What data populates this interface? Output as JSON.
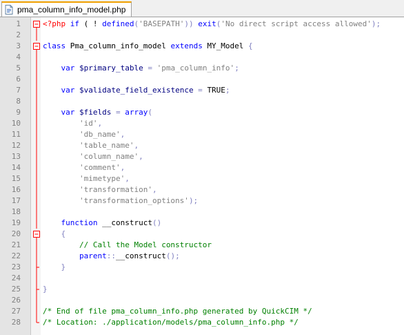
{
  "tab": {
    "title": "pma_column_info_model.php",
    "icon": "php-file-icon"
  },
  "lines": [
    {
      "n": "1",
      "fold": "open",
      "tokens": [
        [
          "php",
          "<?php "
        ],
        [
          "kw",
          "if"
        ],
        [
          "txt",
          " ( ! "
        ],
        [
          "kw",
          "defined"
        ],
        [
          "op",
          "("
        ],
        [
          "str",
          "'BASEPATH'"
        ],
        [
          "op",
          "))"
        ],
        [
          "txt",
          " "
        ],
        [
          "kw",
          "exit"
        ],
        [
          "op",
          "("
        ],
        [
          "str",
          "'No direct script access allowed'"
        ],
        [
          "op",
          ");"
        ]
      ]
    },
    {
      "n": "2",
      "fold": "line",
      "tokens": []
    },
    {
      "n": "3",
      "fold": "open",
      "tokens": [
        [
          "kw",
          "class"
        ],
        [
          "txt",
          " Pma_column_info_model "
        ],
        [
          "kw",
          "extends"
        ],
        [
          "txt",
          " MY_Model "
        ],
        [
          "brace",
          "{"
        ]
      ]
    },
    {
      "n": "4",
      "fold": "line",
      "tokens": []
    },
    {
      "n": "5",
      "fold": "line",
      "tokens": [
        [
          "txt",
          "    "
        ],
        [
          "kw",
          "var"
        ],
        [
          "var",
          " $primary_table"
        ],
        [
          "op",
          " = "
        ],
        [
          "str",
          "'pma_column_info'"
        ],
        [
          "op",
          ";"
        ]
      ]
    },
    {
      "n": "6",
      "fold": "line",
      "tokens": []
    },
    {
      "n": "7",
      "fold": "line",
      "tokens": [
        [
          "txt",
          "    "
        ],
        [
          "kw",
          "var"
        ],
        [
          "var",
          " $validate_field_existence"
        ],
        [
          "op",
          " = "
        ],
        [
          "bool",
          "TRUE"
        ],
        [
          "op",
          ";"
        ]
      ]
    },
    {
      "n": "8",
      "fold": "line",
      "tokens": []
    },
    {
      "n": "9",
      "fold": "line",
      "tokens": [
        [
          "txt",
          "    "
        ],
        [
          "kw",
          "var"
        ],
        [
          "var",
          " $fields"
        ],
        [
          "op",
          " = "
        ],
        [
          "kw",
          "array"
        ],
        [
          "op",
          "("
        ]
      ]
    },
    {
      "n": "10",
      "fold": "line",
      "tokens": [
        [
          "txt",
          "        "
        ],
        [
          "str",
          "'id'"
        ],
        [
          "op",
          ","
        ]
      ]
    },
    {
      "n": "11",
      "fold": "line",
      "tokens": [
        [
          "txt",
          "        "
        ],
        [
          "str",
          "'db_name'"
        ],
        [
          "op",
          ","
        ]
      ]
    },
    {
      "n": "12",
      "fold": "line",
      "tokens": [
        [
          "txt",
          "        "
        ],
        [
          "str",
          "'table_name'"
        ],
        [
          "op",
          ","
        ]
      ]
    },
    {
      "n": "13",
      "fold": "line",
      "tokens": [
        [
          "txt",
          "        "
        ],
        [
          "str",
          "'column_name'"
        ],
        [
          "op",
          ","
        ]
      ]
    },
    {
      "n": "14",
      "fold": "line",
      "tokens": [
        [
          "txt",
          "        "
        ],
        [
          "str",
          "'comment'"
        ],
        [
          "op",
          ","
        ]
      ]
    },
    {
      "n": "15",
      "fold": "line",
      "tokens": [
        [
          "txt",
          "        "
        ],
        [
          "str",
          "'mimetype'"
        ],
        [
          "op",
          ","
        ]
      ]
    },
    {
      "n": "16",
      "fold": "line",
      "tokens": [
        [
          "txt",
          "        "
        ],
        [
          "str",
          "'transformation'"
        ],
        [
          "op",
          ","
        ]
      ]
    },
    {
      "n": "17",
      "fold": "line",
      "tokens": [
        [
          "txt",
          "        "
        ],
        [
          "str",
          "'transformation_options'"
        ],
        [
          "op",
          ");"
        ]
      ]
    },
    {
      "n": "18",
      "fold": "line",
      "tokens": []
    },
    {
      "n": "19",
      "fold": "line",
      "tokens": [
        [
          "txt",
          "    "
        ],
        [
          "kw",
          "function"
        ],
        [
          "txt",
          " __construct"
        ],
        [
          "op",
          "()"
        ]
      ]
    },
    {
      "n": "20",
      "fold": "open",
      "tokens": [
        [
          "txt",
          "    "
        ],
        [
          "brace",
          "{"
        ]
      ]
    },
    {
      "n": "21",
      "fold": "line",
      "tokens": [
        [
          "txt",
          "        "
        ],
        [
          "com",
          "// Call the Model constructor"
        ]
      ]
    },
    {
      "n": "22",
      "fold": "line",
      "tokens": [
        [
          "txt",
          "        "
        ],
        [
          "kw",
          "parent"
        ],
        [
          "op",
          "::"
        ],
        [
          "txt",
          "__construct"
        ],
        [
          "op",
          "();"
        ]
      ]
    },
    {
      "n": "23",
      "fold": "end",
      "tokens": [
        [
          "txt",
          "    "
        ],
        [
          "brace",
          "}"
        ]
      ]
    },
    {
      "n": "24",
      "fold": "line",
      "tokens": []
    },
    {
      "n": "25",
      "fold": "end",
      "tokens": [
        [
          "brace",
          "}"
        ]
      ]
    },
    {
      "n": "26",
      "fold": "line",
      "tokens": []
    },
    {
      "n": "27",
      "fold": "line",
      "tokens": [
        [
          "com",
          "/* End of file pma_column_info.php generated by QuickCIM */"
        ]
      ]
    },
    {
      "n": "28",
      "fold": "last",
      "tokens": [
        [
          "com",
          "/* Location: ./application/models/pma_column_info.php */"
        ]
      ]
    }
  ],
  "colors": {
    "keyword": "#0000ff",
    "variable": "#000080",
    "string": "#808080",
    "comment": "#008000",
    "php_tag": "#ff0000",
    "fold_mark": "#ff0000"
  }
}
